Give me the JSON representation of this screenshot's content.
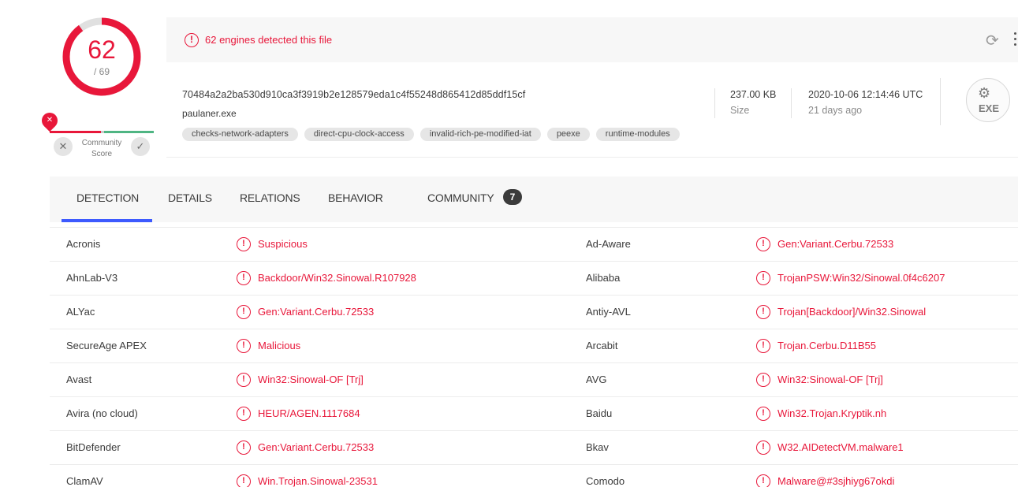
{
  "score": {
    "detected": "62",
    "total": "/ 69",
    "fraction": 0.8986,
    "color": "#e8173a"
  },
  "community": {
    "label_line1": "Community",
    "label_line2": "Score",
    "down_icon": "close-icon",
    "up_icon": "check-icon",
    "pin_icon": "x-mark-icon"
  },
  "alert": {
    "text": "62 engines detected this file",
    "icon": "alert-circle-icon",
    "reload_icon": "reload-icon",
    "more_icon": "more-vert-icon"
  },
  "file": {
    "hash": "70484a2a2ba530d910ca3f3919b2e128579eda1c4f55248d865412d85ddf15cf",
    "name": "paulaner.exe",
    "tags": [
      "checks-network-adapters",
      "direct-cpu-clock-access",
      "invalid-rich-pe-modified-iat",
      "peexe",
      "runtime-modules"
    ],
    "size_value": "237.00 KB",
    "size_label": "Size",
    "date_value": "2020-10-06 12:14:46 UTC",
    "date_label": "21 days ago",
    "type_label": "EXE"
  },
  "tabs": [
    {
      "label": "DETECTION",
      "active": true
    },
    {
      "label": "DETAILS"
    },
    {
      "label": "RELATIONS"
    },
    {
      "label": "BEHAVIOR"
    },
    {
      "label": "COMMUNITY",
      "badge": "7"
    }
  ],
  "detections": [
    {
      "engine_left": "Acronis",
      "result_left": "Suspicious",
      "engine_right": "Ad-Aware",
      "result_right": "Gen:Variant.Cerbu.72533"
    },
    {
      "engine_left": "AhnLab-V3",
      "result_left": "Backdoor/Win32.Sinowal.R107928",
      "engine_right": "Alibaba",
      "result_right": "TrojanPSW:Win32/Sinowal.0f4c6207"
    },
    {
      "engine_left": "ALYac",
      "result_left": "Gen:Variant.Cerbu.72533",
      "engine_right": "Antiy-AVL",
      "result_right": "Trojan[Backdoor]/Win32.Sinowal"
    },
    {
      "engine_left": "SecureAge APEX",
      "result_left": "Malicious",
      "engine_right": "Arcabit",
      "result_right": "Trojan.Cerbu.D11B55"
    },
    {
      "engine_left": "Avast",
      "result_left": "Win32:Sinowal-OF [Trj]",
      "engine_right": "AVG",
      "result_right": "Win32:Sinowal-OF [Trj]"
    },
    {
      "engine_left": "Avira (no cloud)",
      "result_left": "HEUR/AGEN.1117684",
      "engine_right": "Baidu",
      "result_right": "Win32.Trojan.Kryptik.nh"
    },
    {
      "engine_left": "BitDefender",
      "result_left": "Gen:Variant.Cerbu.72533",
      "engine_right": "Bkav",
      "result_right": "W32.AIDetectVM.malware1"
    },
    {
      "engine_left": "ClamAV",
      "result_left": "Win.Trojan.Sinowal-23531",
      "engine_right": "Comodo",
      "result_right": "Malware@#3sjhiyg67okdi"
    }
  ]
}
